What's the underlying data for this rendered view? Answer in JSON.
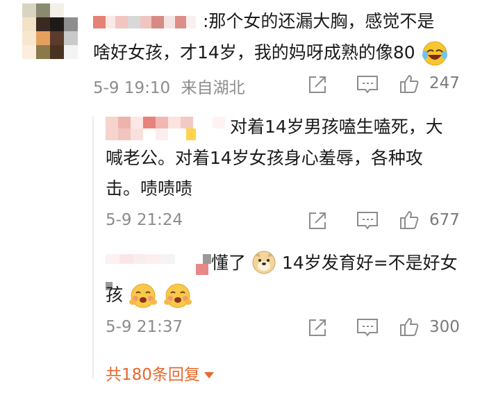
{
  "main_comment": {
    "text_line1": ":那个女的还漏大胸，感觉不是",
    "text_line2": "啥好女孩，才14岁，我的妈呀成熟的像80",
    "time": "5-9 19:10",
    "location": "来自湖北",
    "like_count": "247",
    "emoji_trailing": "laugh-cry-emoji"
  },
  "replies": [
    {
      "text_line1": "对着14岁男孩嗑生嗑死，大",
      "text_line2": "喊老公。对着14岁女孩身心羞辱，各种攻",
      "text_line3": "击。啧啧啧",
      "time": "5-9 21:24",
      "like_count": "677"
    },
    {
      "text_prefix": "懂了",
      "text_after_emoji": "14岁发育好=不是好女",
      "text_line2": "孩",
      "emoji_inline": "doge-emoji",
      "emoji_trailing": "shy-blush-emoji",
      "time": "5-9 21:37",
      "like_count": "300"
    }
  ],
  "footer": {
    "more_replies": "共180条回复"
  },
  "icons": {
    "share": "share-icon",
    "comment": "comment-icon",
    "like": "thumbs-up-icon",
    "expand": "caret-down-icon"
  },
  "colors": {
    "accent": "#e8682c",
    "meta_text": "#8c8c8c",
    "divider": "#ececec"
  }
}
